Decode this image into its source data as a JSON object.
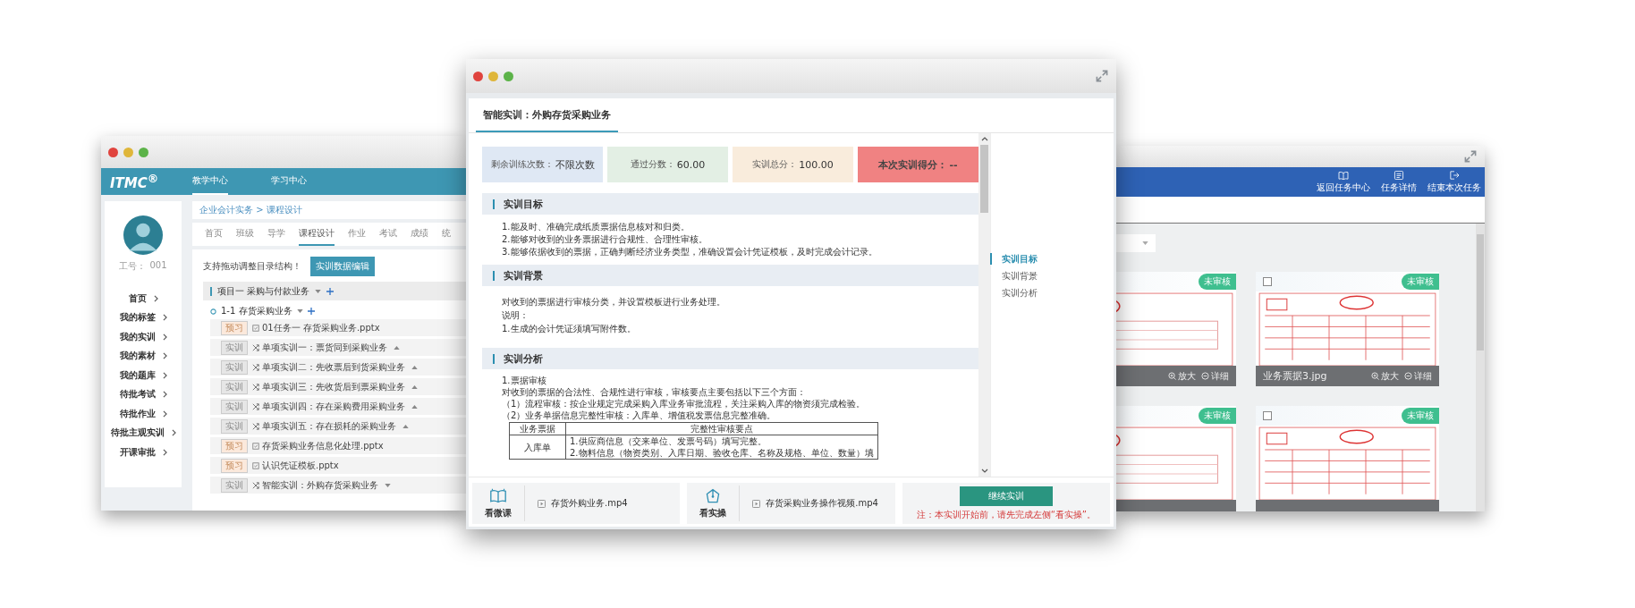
{
  "left_window": {
    "logo": "ITMC$^{®}$",
    "nav": [
      {
        "label": "教学中心",
        "selected": true
      },
      {
        "label": "学习中心",
        "selected": false
      }
    ],
    "staff_id_label": "工号：",
    "staff_id": "001",
    "sidebar": [
      "首页",
      "我的标签",
      "我的实训",
      "我的素材",
      "我的题库",
      "待批考试",
      "待批作业",
      "待批主观实训",
      "开课审批"
    ],
    "breadcrumb": "企业会计实务 > 课程设计",
    "tabs": [
      {
        "label": "首页",
        "selected": false
      },
      {
        "label": "班级",
        "selected": false
      },
      {
        "label": "导学",
        "selected": false
      },
      {
        "label": "课程设计",
        "selected": true
      },
      {
        "label": "作业",
        "selected": false
      },
      {
        "label": "考试",
        "selected": false
      },
      {
        "label": "成绩",
        "selected": false
      },
      {
        "label": "统",
        "selected": false
      }
    ],
    "hint": "支持拖动调整目录结构！",
    "action_button": "实训数据编辑",
    "project": "项目一 采购与付款业务",
    "task": "1-1 存货采购业务",
    "items": [
      {
        "kind": "preview",
        "tag": "预习",
        "text": "01任务一 存货采购业务.pptx"
      },
      {
        "kind": "training",
        "tag": "实训",
        "text": "单项实训一：票货同到采购业务",
        "expanded": true
      },
      {
        "kind": "training",
        "tag": "实训",
        "text": "单项实训二：先收票后到货采购业务",
        "expanded": true
      },
      {
        "kind": "training",
        "tag": "实训",
        "text": "单项实训三：先收货后到票采购业务",
        "expanded": true
      },
      {
        "kind": "training",
        "tag": "实训",
        "text": "单项实训四：存在采购费用采购业务",
        "expanded": true
      },
      {
        "kind": "training",
        "tag": "实训",
        "text": "单项实训五：存在损耗的采购业务",
        "expanded": true
      },
      {
        "kind": "preview",
        "tag": "预习",
        "text": "存货采购业务信息化处理.pptx"
      },
      {
        "kind": "preview",
        "tag": "预习",
        "text": "认识凭证模板.pptx"
      },
      {
        "kind": "training",
        "tag": "实训",
        "text": "智能实训：外购存货采购业务",
        "expanded": false
      }
    ]
  },
  "center_window": {
    "title": "智能实训：外购存货采购业务",
    "stats": [
      {
        "kind": "remaining",
        "label": "剩余训练次数：",
        "value": "不限次数"
      },
      {
        "kind": "pass",
        "label": "通过分数：",
        "value": "60.00"
      },
      {
        "kind": "total",
        "label": "实训总分：",
        "value": "100.00"
      },
      {
        "kind": "score",
        "label": "本次实训得分：",
        "value": "--"
      }
    ],
    "sections": [
      {
        "heading": "实训目标",
        "lines": [
          "1.能及时、准确完成纸质票据信息核对和归类。",
          "2.能够对收到的业务票据进行合规性、合理性审核。",
          "3.能够依据收到的票据，正确判断经济业务类型，准确设置会计凭证模板，及时完成会计记录。"
        ]
      },
      {
        "heading": "实训背景",
        "lines": [
          "对收到的票据进行审核分类，并设置模板进行业务处理。",
          "说明：",
          "1.生成的会计凭证须填写附件数。"
        ]
      },
      {
        "heading": "实训分析",
        "lines": [
          "1.票据审核",
          "对收到的票据的合法性、合规性进行审核，审核要点主要包括以下三个方面：",
          "（1）流程审核：按企业规定完成采购入库业务审批流程，关注采购入库的物资须完成检验。",
          "（2）业务单据信息完整性审核：入库单、增值税发票信息完整准确。"
        ],
        "table": {
          "columns": [
            "业务票据",
            "完整性审核要点"
          ],
          "rows": [
            {
              "document": "入库单",
              "points": [
                "1.供应商信息（交来单位、发票号码）填写完整。",
                "2.物料信息（物资类别、入库日期、验收仓库、名称及规格、单位、数量）填"
              ]
            }
          ]
        }
      }
    ],
    "nav": [
      {
        "label": "实训目标",
        "selected": true
      },
      {
        "label": "实训背景",
        "selected": false
      },
      {
        "label": "实训分析",
        "selected": false
      }
    ],
    "resources": [
      {
        "kind": "lesson",
        "label": "看微课",
        "file": "存货外购业务.mp4"
      },
      {
        "kind": "practice",
        "label": "看实操",
        "file": "存货采购业务操作视频.mp4"
      }
    ],
    "continue_button": "继续实训",
    "notice": "注：本实训开始前，请先完成左侧“看实操”。"
  },
  "right_window": {
    "toolbar": [
      {
        "kind": "return",
        "label": "返回任务中心"
      },
      {
        "kind": "details",
        "label": "任务详情"
      },
      {
        "kind": "end",
        "label": "结束本次任务"
      }
    ],
    "cards": [
      {
        "status": "未审核",
        "actions": [
          "放大",
          "详细"
        ]
      },
      {
        "status": "未审核",
        "checked": false,
        "name": "业务票据3.jpg",
        "actions": [
          "放大",
          "详细"
        ]
      },
      {
        "status": "未审核"
      },
      {
        "status": "未审核",
        "checked": false
      }
    ]
  }
}
